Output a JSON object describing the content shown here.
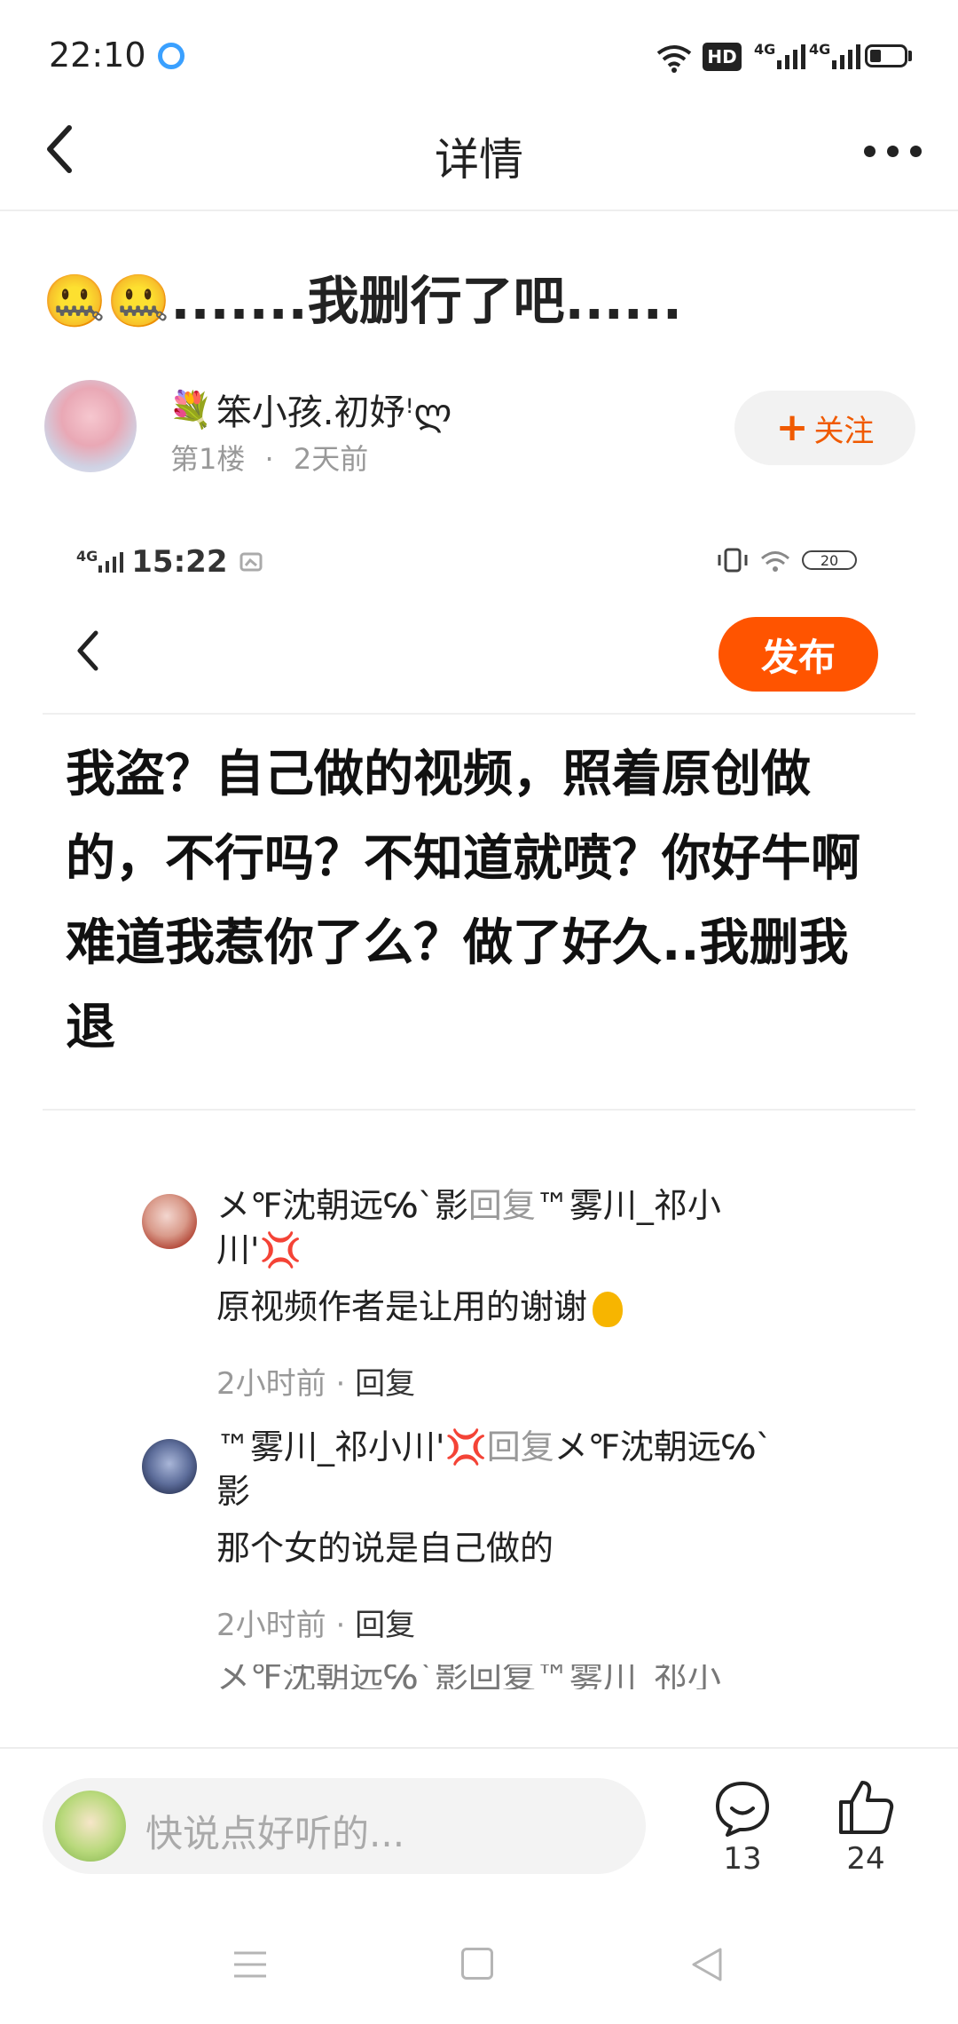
{
  "status_bar": {
    "time": "22:10",
    "hd_label": "HD",
    "network_1": "4G",
    "network_2": "4G",
    "icons": [
      "browser-app-icon",
      "wifi-icon",
      "signal-icon",
      "signal-icon",
      "battery-icon"
    ]
  },
  "header": {
    "title": "详情",
    "back_icon": "chevron-left-icon",
    "more_icon": "more-horizontal-icon"
  },
  "post": {
    "title": "🤐🤐.......我删行了吧......",
    "author": {
      "name_emoji": "💐",
      "name": "笨小孩.初妤ꜝლ",
      "floor": "第1楼",
      "time": "2天前",
      "follow_label": "关注",
      "follow_plus": "+"
    }
  },
  "embedded_screenshot": {
    "status_time": "15:22",
    "network_label": "4G",
    "battery_level": "20",
    "publish_label": "发布",
    "body": "我盗？自己做的视频，照着原创做的，不行吗？不知道就喷？你好牛啊难道我惹你了么？做了好久..我删我退",
    "replies": [
      {
        "from": "メ℉沈朝远℅`影",
        "reply_word": "回复",
        "to": "™雾川_祁小川'",
        "to_emoji": "💢",
        "text": "原视频作者是让用的谢谢",
        "time": "2小时前",
        "reply_action": "回复"
      },
      {
        "from": "™雾川_祁小川'",
        "from_emoji": "💢",
        "reply_word": "回复",
        "to": "メ℉沈朝远℅`影",
        "text": "那个女的说是自己做的",
        "time": "2小时前",
        "reply_action": "回复"
      }
    ],
    "cutoff_text": "メ℉沈朝远℅`影回复™雾川_祁小"
  },
  "bottom_bar": {
    "comment_placeholder": "快说点好听的...",
    "comment_count": "13",
    "like_count": "24"
  },
  "colors": {
    "accent": "#ff5400",
    "follow_text": "#f05a00",
    "muted": "#999999"
  }
}
